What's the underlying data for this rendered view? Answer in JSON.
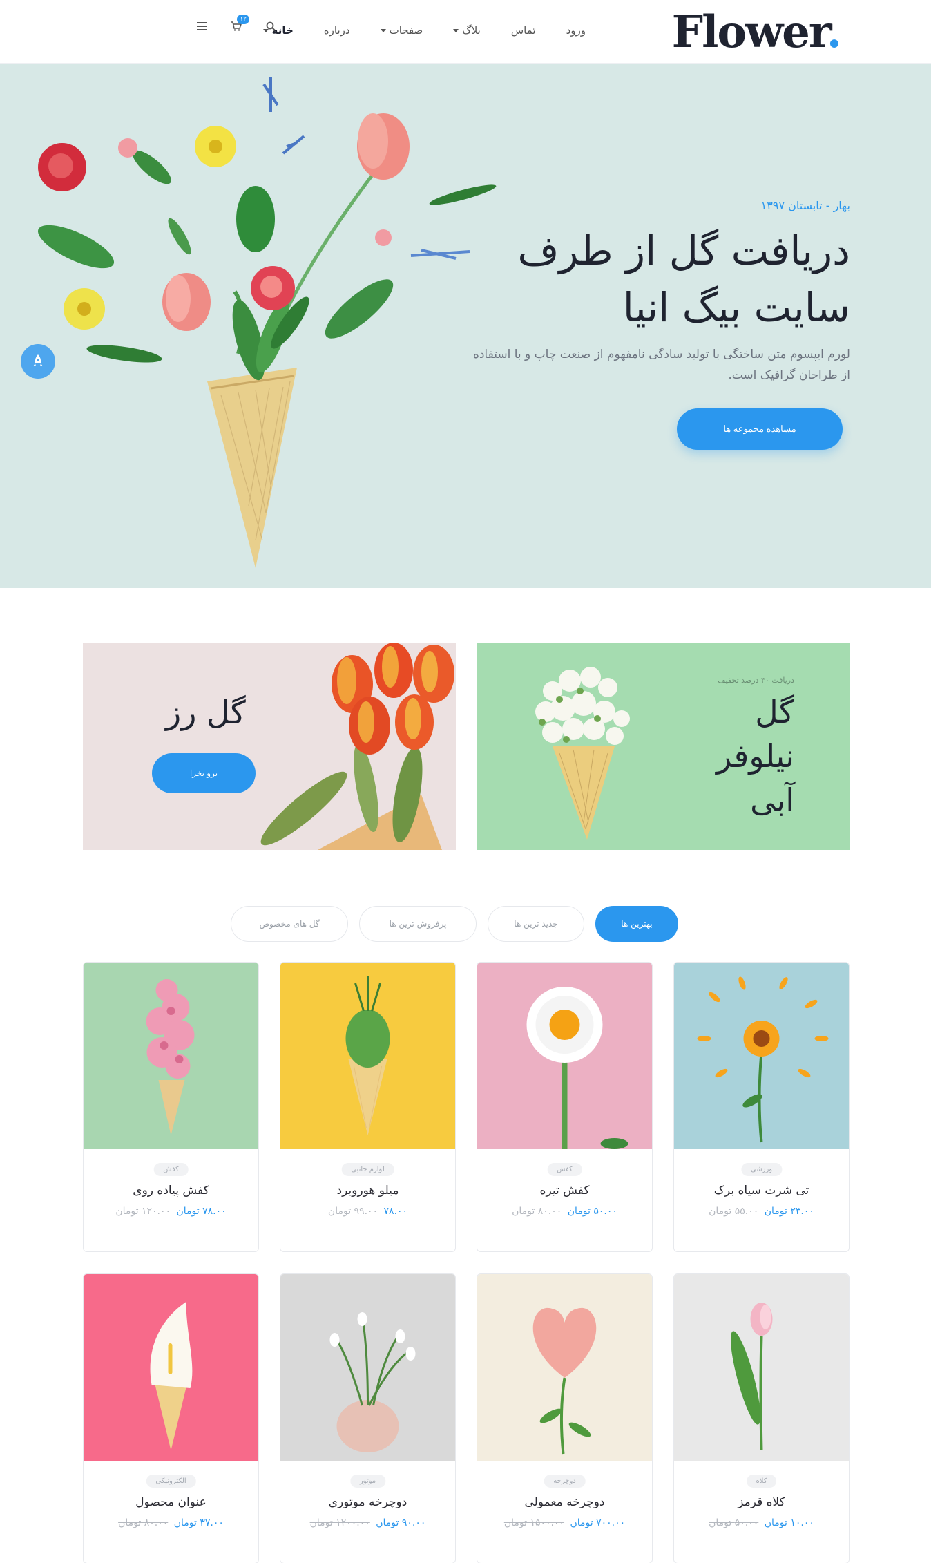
{
  "header": {
    "logo": "Flower",
    "logo_dot": ".",
    "nav": [
      {
        "label": "خانه",
        "caret": true,
        "active": true
      },
      {
        "label": "درباره",
        "caret": false,
        "active": false
      },
      {
        "label": "صفحات",
        "caret": true,
        "active": false
      },
      {
        "label": "بلاگ",
        "caret": true,
        "active": false
      },
      {
        "label": "تماس",
        "caret": false,
        "active": false
      },
      {
        "label": "ورود",
        "caret": false,
        "active": false
      }
    ],
    "cart_count": "۱۲"
  },
  "hero": {
    "eyebrow": "بهار - تابستان ۱۳۹۷",
    "title_line1": "دریافت گل از طرف",
    "title_line2": "سایت بیگ انیا",
    "description": "لورم ایپسوم متن ساختگی با تولید سادگی نامفهوم از صنعت چاپ و با استفاده از طراحان گرافیک است.",
    "button": "مشاهده مجموعه ها",
    "bg_color": "#d7e8e6"
  },
  "promos": {
    "left": {
      "title": "گل رز",
      "button": "برو بخرا"
    },
    "right": {
      "eyebrow": "دریافت ۳۰ درصد تخفیف",
      "title": "گل نیلوفر آبی"
    }
  },
  "tabs": [
    {
      "label": "بهترین ها",
      "active": true
    },
    {
      "label": "جدید ترین ها",
      "active": false
    },
    {
      "label": "پرفروش ترین ها",
      "active": false
    },
    {
      "label": "گل های مخصوص",
      "active": false
    }
  ],
  "products": [
    {
      "category": "ورزشی",
      "name": "تی شرت سیاه برک",
      "price": "۲۳.۰۰ تومان",
      "old_price": "۵۵.۰۰ تومان",
      "bg": "#a9d2da"
    },
    {
      "category": "کفش",
      "name": "کفش تیره",
      "price": "۵۰.۰۰ تومان",
      "old_price": "۸۰.۰۰ تومان",
      "bg": "#ecb0c3"
    },
    {
      "category": "لوازم جانبی",
      "name": "میلو هوروبرد",
      "price": "۷۸.۰۰",
      "old_price": "۹۹.۰۰ تومان",
      "bg": "#f7cb3f"
    },
    {
      "category": "کفش",
      "name": "کفش پیاده روی",
      "price": "۷۸.۰۰ تومان",
      "old_price": "۱۲۰.۰۰ تومان",
      "bg": "#a8d6b0"
    },
    {
      "category": "کلاه",
      "name": "کلاه قرمز",
      "price": "۱۰.۰۰ تومان",
      "old_price": "۵۰.۰۰ تومان",
      "bg": "#e8e8e8"
    },
    {
      "category": "دوچرخه",
      "name": "دوچرخه معمولی",
      "price": "۷۰۰.۰۰ تومان",
      "old_price": "۱۵۰۰.۰۰ تومان",
      "bg": "#f3eddf"
    },
    {
      "category": "موتور",
      "name": "دوچرخه موتوری",
      "price": "۹۰.۰۰ تومان",
      "old_price": "۱۲۰۰.۰۰ تومان",
      "bg": "#d9d9d9"
    },
    {
      "category": "الکترونیکی",
      "name": "عنوان محصول",
      "price": "۳۷.۰۰ تومان",
      "old_price": "۸۰.۰۰ تومان",
      "bg": "#f76a8a"
    }
  ],
  "colors": {
    "accent": "#2b97ee",
    "text_dark": "#1f2330"
  }
}
